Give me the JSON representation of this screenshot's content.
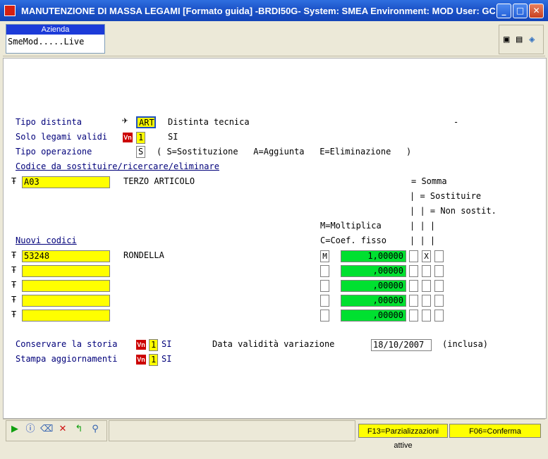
{
  "window": {
    "title": "MANUTENZIONE DI MASSA LEGAMI [Formato guida] -BRDI50G- System: SMEA Environment: MOD User: GC - ..."
  },
  "azienda": {
    "header": "Azienda",
    "value": "SmeMod.....Live"
  },
  "form": {
    "tipo_distinta": {
      "label": "Tipo distinta",
      "value": "ART",
      "desc": "Distinta tecnica",
      "dash": "-"
    },
    "solo_legami": {
      "label": "Solo legami validi",
      "value": "1",
      "desc": "SI"
    },
    "tipo_operazione": {
      "label": "Tipo operazione",
      "value": "S",
      "options": "( S=Sostituzione   A=Aggiunta   E=Eliminazione   )"
    },
    "codice_header": "Codice da sostituire/ricercare/eliminare",
    "codice": {
      "value": "A03",
      "desc": "TERZO ARTICOLO"
    },
    "legend": {
      "somma": "= Somma",
      "sostituire": "| = Sostituire",
      "non_sostit": "| | = Non sostit.",
      "moltiplica": "M=Moltiplica",
      "coef": "C=Coef. fisso",
      "bars3": "| | |"
    },
    "nuovi_header": "Nuovi codici",
    "rows": [
      {
        "code": "53248",
        "desc": "RONDELLA",
        "mc": "M",
        "coef": "1,00000",
        "c1": "",
        "c2": "X",
        "c3": ""
      },
      {
        "code": "",
        "desc": "",
        "mc": "",
        "coef": ",00000",
        "c1": "",
        "c2": "",
        "c3": ""
      },
      {
        "code": "",
        "desc": "",
        "mc": "",
        "coef": ",00000",
        "c1": "",
        "c2": "",
        "c3": ""
      },
      {
        "code": "",
        "desc": "",
        "mc": "",
        "coef": ",00000",
        "c1": "",
        "c2": "",
        "c3": ""
      },
      {
        "code": "",
        "desc": "",
        "mc": "",
        "coef": ",00000",
        "c1": "",
        "c2": "",
        "c3": ""
      }
    ],
    "conservare": {
      "label": "Conservare la storia",
      "value": "1",
      "desc": "SI"
    },
    "stampa": {
      "label": "Stampa aggiornamenti",
      "value": "1",
      "desc": "SI"
    },
    "data_validita": {
      "label": "Data validità variazione",
      "value": "18/10/2007",
      "suffix": "(inclusa)"
    }
  },
  "badge_text": "Vn",
  "fkeys": {
    "f13": "F13=Parzializzazioni attive",
    "f06": "F06=Conferma"
  },
  "colors": {
    "titlebar": "#1c53c8",
    "field_yellow": "#ffff00",
    "field_green": "#00e030",
    "label_blue": "#00007a"
  }
}
